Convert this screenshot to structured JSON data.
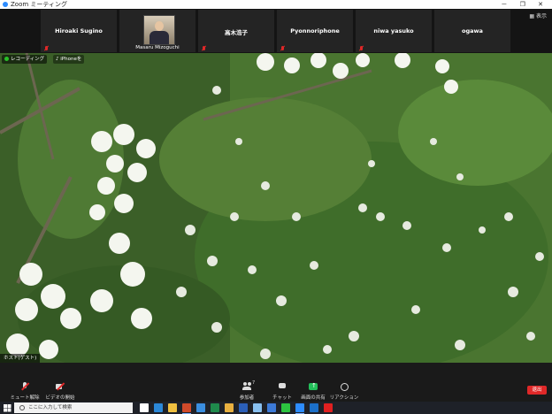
{
  "window": {
    "title": "Zoom ミーティング",
    "controls": "－ ❐ ✕"
  },
  "participants": [
    {
      "name": "Hiroaki Sugino",
      "muted": true,
      "has_photo": false
    },
    {
      "name": "Masaru Mizoguchi",
      "muted": false,
      "has_photo": true
    },
    {
      "name": "高木浩子",
      "muted": true,
      "has_photo": false
    },
    {
      "name": "Pyonnoriphone",
      "muted": true,
      "has_photo": false
    },
    {
      "name": "niwa yasuko",
      "muted": true,
      "has_photo": false
    },
    {
      "name": "ogawa",
      "muted": false,
      "has_photo": false
    }
  ],
  "view_button": "表示",
  "video": {
    "recording_label": "レコーディング",
    "share_label": "♪ iPhoneを",
    "speaker_label": "ホスト(ゲスト)"
  },
  "toolbar": {
    "mute": "ミュート解除",
    "video": "ビデオの開始",
    "participants": "参加者",
    "participant_count": "7",
    "chat": "チャット",
    "share": "画面の共有",
    "reactions": "リアクション",
    "end": "退出"
  },
  "taskbar": {
    "search_placeholder": "ここに入力して検索",
    "apps": [
      {
        "name": "task-view-icon",
        "color": "#ffffff"
      },
      {
        "name": "edge-icon",
        "color": "#2b88d8"
      },
      {
        "name": "explorer-icon",
        "color": "#f0c040"
      },
      {
        "name": "powerpoint-icon",
        "color": "#d04a2a"
      },
      {
        "name": "mail-icon",
        "color": "#3a8ee0"
      },
      {
        "name": "excel-icon",
        "color": "#1f8a4c"
      },
      {
        "name": "chrome-icon",
        "color": "#e8b040"
      },
      {
        "name": "word-icon",
        "color": "#2b5fb8"
      },
      {
        "name": "store-icon",
        "color": "#88c0f0"
      },
      {
        "name": "photos-icon",
        "color": "#3c7ad8"
      },
      {
        "name": "line-icon",
        "color": "#2cc440"
      },
      {
        "name": "zoom-icon",
        "color": "#2d8cff"
      },
      {
        "name": "outlook-icon",
        "color": "#1b6fc8"
      },
      {
        "name": "acrobat-icon",
        "color": "#e02020"
      }
    ]
  }
}
